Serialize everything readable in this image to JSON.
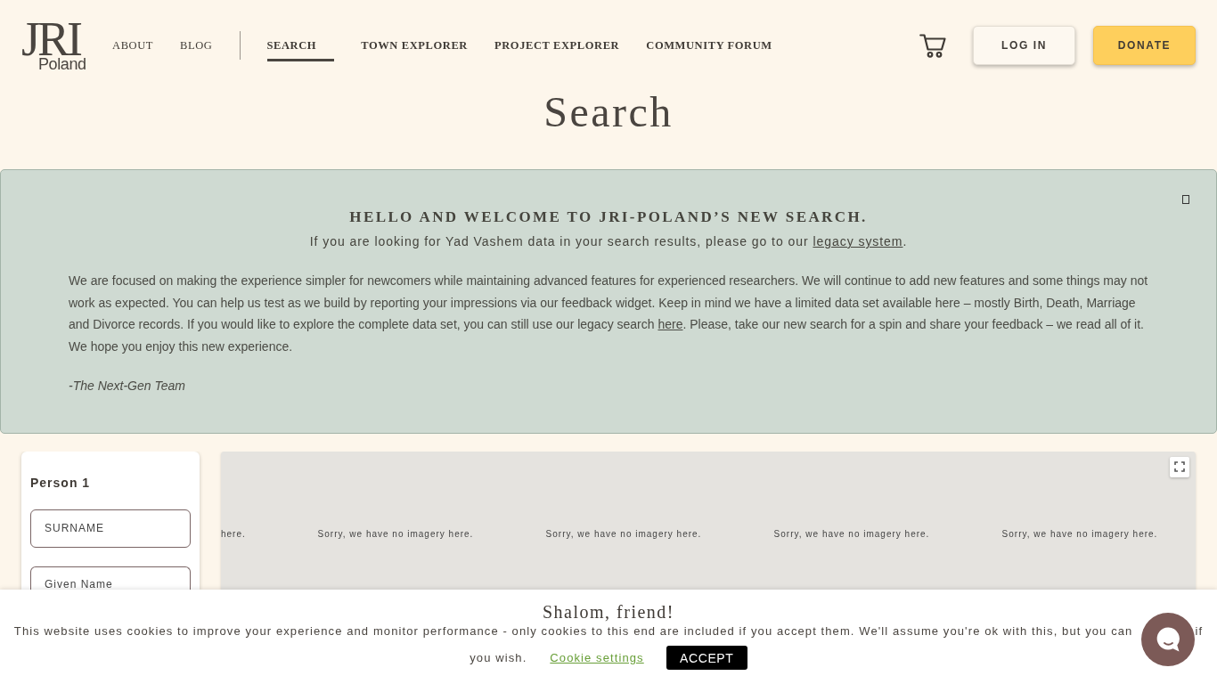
{
  "header": {
    "logo": {
      "main": "JRI",
      "sub": "Poland"
    },
    "secondary_nav": [
      {
        "label": "ABOUT",
        "selected": false
      },
      {
        "label": "BLOG",
        "selected": false
      }
    ],
    "main_nav": [
      {
        "label": "SEARCH",
        "selected": true
      },
      {
        "label": "TOWN EXPLORER",
        "selected": false
      },
      {
        "label": "PROJECT EXPLORER",
        "selected": false
      },
      {
        "label": "COMMUNITY FORUM",
        "selected": false
      }
    ],
    "buttons": [
      {
        "label": "LOG IN",
        "kind": "outline"
      },
      {
        "label": "DONATE",
        "kind": "filled"
      }
    ]
  },
  "page_title": "Search",
  "welcome_banner": {
    "heading": "HELLO AND WELCOME TO JRI-POLAND’S NEW SEARCH.",
    "intro": {
      "before": "If you are looking for Yad Vashem data in your search results, please go to our ",
      "link": "legacy system",
      "after": "."
    },
    "body": {
      "before": "We are focused on making the experience simpler for newcomers while maintaining advanced features for experienced researchers. We will continue to add new features and some things may not work as expected. You can help us test as we build by reporting your impressions via our feedback widget. Keep in mind we have a limited data set available here – mostly Birth, Death, Marriage and Divorce records. If you would like to explore the complete data set, you can still use our legacy search ",
      "link": "here",
      "after": ". Please, take our new search for a spin and share your feedback – we read all of it. We hope you enjoy this new experience."
    },
    "signature": "-The Next-Gen Team"
  },
  "search_panel": {
    "title": "Person 1",
    "fields": [
      {
        "placeholder": "SURNAME"
      },
      {
        "placeholder": "Given Name"
      }
    ]
  },
  "map": {
    "tile_messages": [
      "here.",
      "Sorry, we have no imagery here.",
      "Sorry, we have no imagery here.",
      "Sorry, we have no imagery here.",
      "Sorry, we have no imagery here."
    ]
  },
  "cookie_banner": {
    "title": "Shalom, friend!",
    "message": "This website uses cookies to improve your experience and monitor performance - only cookies to this end are included if you accept them. We'll assume you're ok with this, but you can",
    "message_after_chat": "if",
    "message_end": "you wish.",
    "settings_link": "Cookie settings",
    "accept_button": "ACCEPT"
  }
}
